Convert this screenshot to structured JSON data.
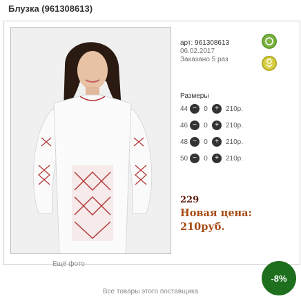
{
  "header": {
    "title": "Блузка (961308613)"
  },
  "product": {
    "article": "арт: 961308613",
    "date": "06.02.2017",
    "ordered": "Заказано 5 раз",
    "more_photo": "Ещё фото"
  },
  "social": {
    "icons": [
      "vk-icon",
      "odnoklassniki-icon"
    ],
    "vk_color": "#7cb342",
    "ok_color": "#d8cf49"
  },
  "sizes": {
    "title": "Размеры",
    "minus_symbol": "−",
    "plus_symbol": "+",
    "rows": [
      {
        "size": "44",
        "qty": "0",
        "price": "210р."
      },
      {
        "size": "46",
        "qty": "0",
        "price": "210р."
      },
      {
        "size": "48",
        "qty": "0",
        "price": "210р."
      },
      {
        "size": "50",
        "qty": "0",
        "price": "210р."
      }
    ]
  },
  "pricing": {
    "old_price": "229",
    "new_price_label": "Новая цена:",
    "new_price": "210руб.",
    "discount": "-8%",
    "discount_color": "#1d6e1d"
  },
  "footer": {
    "link": "Все товары этого поставщика"
  }
}
